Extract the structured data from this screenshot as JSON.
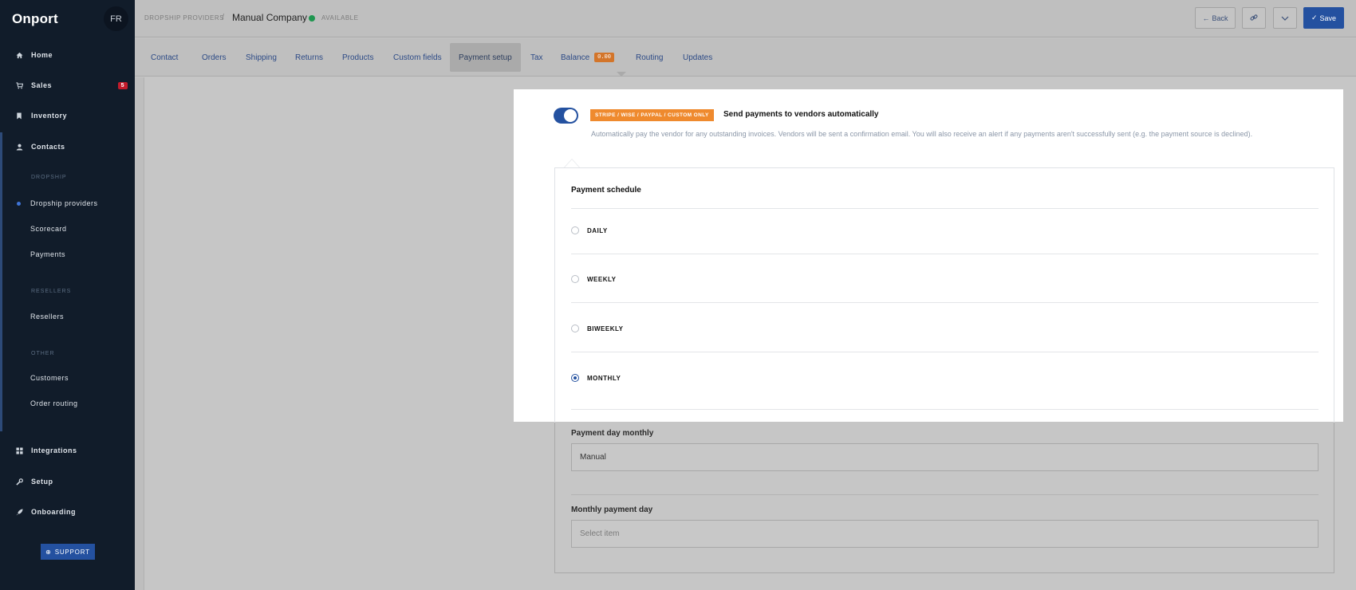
{
  "sidebar": {
    "brand": "Onport",
    "avatar": "FR",
    "nav": {
      "home": "Home",
      "sales": "Sales",
      "sales_badge": "5",
      "inventory": "Inventory",
      "contacts": "Contacts",
      "integrations": "Integrations",
      "setup": "Setup",
      "onboarding": "Onboarding"
    },
    "sections": {
      "dropship": "DROPSHIP",
      "resellers": "RESELLERS",
      "other": "OTHER"
    },
    "sub": {
      "dropship_providers": "Dropship providers",
      "scorecard": "Scorecard",
      "payments": "Payments",
      "resellers": "Resellers",
      "customers": "Customers",
      "order_routing": "Order routing"
    },
    "support": "SUPPORT"
  },
  "header": {
    "breadcrumb_parent": "DROPSHIP PROVIDERS",
    "breadcrumb_sep": "/",
    "title": "Manual Company",
    "status": "AVAILABLE",
    "status_color": "#1f9650",
    "back": "Back",
    "save": "Save"
  },
  "tabs": {
    "contact": "Contact",
    "orders": "Orders",
    "shipping": "Shipping",
    "returns": "Returns",
    "products": "Products",
    "custom_fields": "Custom fields",
    "payment_setup": "Payment setup",
    "tax": "Tax",
    "balance": "Balance",
    "balance_value": "0.00",
    "routing": "Routing",
    "updates": "Updates"
  },
  "payments": {
    "auto_enabled": true,
    "badge": "STRIPE / WISE / PAYPAL / CUSTOM ONLY",
    "auto_title": "Send payments to vendors automatically",
    "auto_desc": "Automatically pay the vendor for any outstanding invoices. Vendors will be sent a confirmation email. You will also receive an alert if any payments aren't successfully sent (e.g. the payment source is declined).",
    "schedule_title": "Payment schedule",
    "options": {
      "daily": "DAILY",
      "weekly": "WEEKLY",
      "biweekly": "BIWEEKLY",
      "monthly": "MONTHLY"
    },
    "selected": "MONTHLY",
    "day_monthly_label": "Payment day monthly",
    "day_monthly_value": "Manual",
    "monthly_day_label": "Monthly payment day",
    "monthly_day_placeholder": "Select item"
  },
  "colors": {
    "sidebar_bg": "#111c2a",
    "accent": "#2451a0",
    "badge_orange": "#ef8a2e",
    "badge_red": "#c21b2b"
  }
}
